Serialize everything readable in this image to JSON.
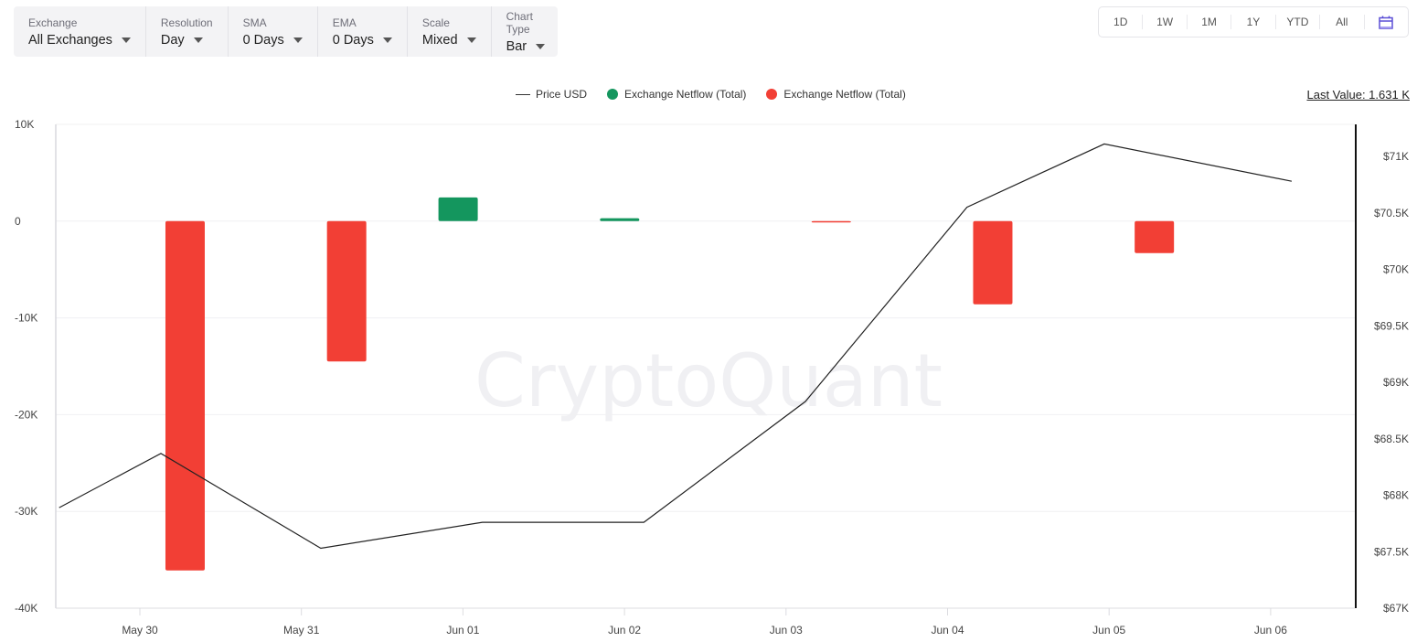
{
  "toolbar": {
    "items": [
      {
        "label": "Exchange",
        "value": "All Exchanges"
      },
      {
        "label": "Resolution",
        "value": "Day"
      },
      {
        "label": "SMA",
        "value": "0 Days"
      },
      {
        "label": "EMA",
        "value": "0 Days"
      },
      {
        "label": "Scale",
        "value": "Mixed"
      },
      {
        "label": "Chart Type",
        "value": "Bar"
      }
    ]
  },
  "range": {
    "buttons": [
      "1D",
      "1W",
      "1M",
      "1Y",
      "YTD",
      "All"
    ],
    "calendar_icon": "calendar-icon",
    "calendar_color": "#5b4fd6"
  },
  "legend": {
    "price": "Price USD",
    "inflow": "Exchange Netflow (Total)",
    "outflow": "Exchange Netflow (Total)"
  },
  "last_value": "Last Value: 1.631 K",
  "watermark": "CryptoQuant",
  "colors": {
    "positive": "#14965e",
    "negative": "#f23f35",
    "price_line": "#222222",
    "grid": "#f0f0f2"
  },
  "chart_data": {
    "type": "bar",
    "title": "",
    "xlabel": "",
    "ylabel": "Exchange Netflow (Total)",
    "y2label": "Price USD",
    "x_ticks": [
      "May 30",
      "May 31",
      "Jun 01",
      "Jun 02",
      "Jun 03",
      "Jun 04",
      "Jun 05",
      "Jun 06"
    ],
    "y_ticks": [
      "10K",
      "0",
      "-10K",
      "-20K",
      "-30K",
      "-40K"
    ],
    "y2_ticks": [
      "$71K",
      "$70.5K",
      "$70K",
      "$69.5K",
      "$69K",
      "$68.5K",
      "$68K",
      "$67.5K",
      "$67K"
    ],
    "ylim": [
      -40000,
      10000
    ],
    "y2lim": [
      67000,
      71000
    ],
    "grid": true,
    "legend_position": "top-center",
    "series": [
      {
        "name": "Exchange Netflow (Total)",
        "type": "bar",
        "x": [
          "May 30",
          "May 31",
          "Jun 01",
          "Jun 02",
          "Jun 03",
          "Jun 04",
          "Jun 05"
        ],
        "x_offset_days": [
          0.28,
          1.28,
          1.97,
          2.97,
          4.28,
          5.28,
          6.28
        ],
        "values": [
          -36100,
          -14500,
          2450,
          300,
          -100,
          -8600,
          -3300
        ]
      },
      {
        "name": "Price USD",
        "type": "line",
        "x_offset_days": [
          -0.5,
          0.13,
          1.12,
          2.12,
          3.12,
          4.12,
          5.12,
          5.97,
          7.13
        ],
        "values": [
          67890,
          68370,
          67530,
          67760,
          67760,
          68830,
          70550,
          71110,
          70780
        ]
      }
    ]
  }
}
